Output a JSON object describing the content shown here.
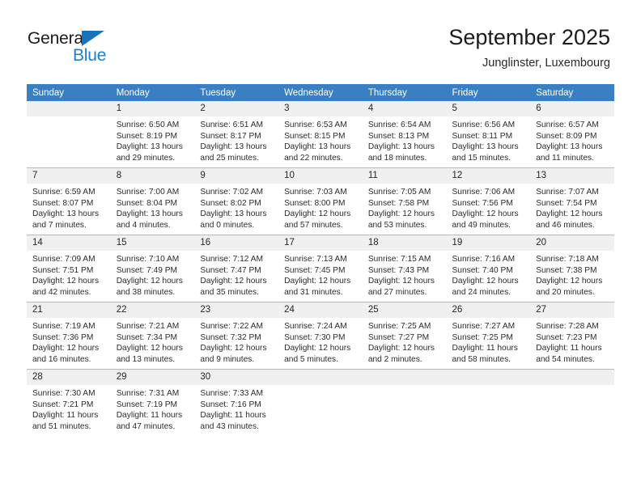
{
  "logo": {
    "word1": "General",
    "word2": "Blue",
    "triangle_color": "#1574bb",
    "blue_color": "#1b7fd4"
  },
  "header": {
    "title": "September 2025",
    "subtitle": "Junglinster, Luxembourg"
  },
  "theme": {
    "header_bg": "#3a7fc1",
    "daynum_bg": "#f0f0f0",
    "grid_line": "#b9b9b9"
  },
  "weekday_headers": [
    "Sunday",
    "Monday",
    "Tuesday",
    "Wednesday",
    "Thursday",
    "Friday",
    "Saturday"
  ],
  "weeks": [
    [
      {
        "day": "",
        "blank": true,
        "sunrise": "",
        "sunset": "",
        "daylight1": "",
        "daylight2": ""
      },
      {
        "day": "1",
        "sunrise": "Sunrise: 6:50 AM",
        "sunset": "Sunset: 8:19 PM",
        "daylight1": "Daylight: 13 hours",
        "daylight2": "and 29 minutes."
      },
      {
        "day": "2",
        "sunrise": "Sunrise: 6:51 AM",
        "sunset": "Sunset: 8:17 PM",
        "daylight1": "Daylight: 13 hours",
        "daylight2": "and 25 minutes."
      },
      {
        "day": "3",
        "sunrise": "Sunrise: 6:53 AM",
        "sunset": "Sunset: 8:15 PM",
        "daylight1": "Daylight: 13 hours",
        "daylight2": "and 22 minutes."
      },
      {
        "day": "4",
        "sunrise": "Sunrise: 6:54 AM",
        "sunset": "Sunset: 8:13 PM",
        "daylight1": "Daylight: 13 hours",
        "daylight2": "and 18 minutes."
      },
      {
        "day": "5",
        "sunrise": "Sunrise: 6:56 AM",
        "sunset": "Sunset: 8:11 PM",
        "daylight1": "Daylight: 13 hours",
        "daylight2": "and 15 minutes."
      },
      {
        "day": "6",
        "sunrise": "Sunrise: 6:57 AM",
        "sunset": "Sunset: 8:09 PM",
        "daylight1": "Daylight: 13 hours",
        "daylight2": "and 11 minutes."
      }
    ],
    [
      {
        "day": "7",
        "sunrise": "Sunrise: 6:59 AM",
        "sunset": "Sunset: 8:07 PM",
        "daylight1": "Daylight: 13 hours",
        "daylight2": "and 7 minutes."
      },
      {
        "day": "8",
        "sunrise": "Sunrise: 7:00 AM",
        "sunset": "Sunset: 8:04 PM",
        "daylight1": "Daylight: 13 hours",
        "daylight2": "and 4 minutes."
      },
      {
        "day": "9",
        "sunrise": "Sunrise: 7:02 AM",
        "sunset": "Sunset: 8:02 PM",
        "daylight1": "Daylight: 13 hours",
        "daylight2": "and 0 minutes."
      },
      {
        "day": "10",
        "sunrise": "Sunrise: 7:03 AM",
        "sunset": "Sunset: 8:00 PM",
        "daylight1": "Daylight: 12 hours",
        "daylight2": "and 57 minutes."
      },
      {
        "day": "11",
        "sunrise": "Sunrise: 7:05 AM",
        "sunset": "Sunset: 7:58 PM",
        "daylight1": "Daylight: 12 hours",
        "daylight2": "and 53 minutes."
      },
      {
        "day": "12",
        "sunrise": "Sunrise: 7:06 AM",
        "sunset": "Sunset: 7:56 PM",
        "daylight1": "Daylight: 12 hours",
        "daylight2": "and 49 minutes."
      },
      {
        "day": "13",
        "sunrise": "Sunrise: 7:07 AM",
        "sunset": "Sunset: 7:54 PM",
        "daylight1": "Daylight: 12 hours",
        "daylight2": "and 46 minutes."
      }
    ],
    [
      {
        "day": "14",
        "sunrise": "Sunrise: 7:09 AM",
        "sunset": "Sunset: 7:51 PM",
        "daylight1": "Daylight: 12 hours",
        "daylight2": "and 42 minutes."
      },
      {
        "day": "15",
        "sunrise": "Sunrise: 7:10 AM",
        "sunset": "Sunset: 7:49 PM",
        "daylight1": "Daylight: 12 hours",
        "daylight2": "and 38 minutes."
      },
      {
        "day": "16",
        "sunrise": "Sunrise: 7:12 AM",
        "sunset": "Sunset: 7:47 PM",
        "daylight1": "Daylight: 12 hours",
        "daylight2": "and 35 minutes."
      },
      {
        "day": "17",
        "sunrise": "Sunrise: 7:13 AM",
        "sunset": "Sunset: 7:45 PM",
        "daylight1": "Daylight: 12 hours",
        "daylight2": "and 31 minutes."
      },
      {
        "day": "18",
        "sunrise": "Sunrise: 7:15 AM",
        "sunset": "Sunset: 7:43 PM",
        "daylight1": "Daylight: 12 hours",
        "daylight2": "and 27 minutes."
      },
      {
        "day": "19",
        "sunrise": "Sunrise: 7:16 AM",
        "sunset": "Sunset: 7:40 PM",
        "daylight1": "Daylight: 12 hours",
        "daylight2": "and 24 minutes."
      },
      {
        "day": "20",
        "sunrise": "Sunrise: 7:18 AM",
        "sunset": "Sunset: 7:38 PM",
        "daylight1": "Daylight: 12 hours",
        "daylight2": "and 20 minutes."
      }
    ],
    [
      {
        "day": "21",
        "sunrise": "Sunrise: 7:19 AM",
        "sunset": "Sunset: 7:36 PM",
        "daylight1": "Daylight: 12 hours",
        "daylight2": "and 16 minutes."
      },
      {
        "day": "22",
        "sunrise": "Sunrise: 7:21 AM",
        "sunset": "Sunset: 7:34 PM",
        "daylight1": "Daylight: 12 hours",
        "daylight2": "and 13 minutes."
      },
      {
        "day": "23",
        "sunrise": "Sunrise: 7:22 AM",
        "sunset": "Sunset: 7:32 PM",
        "daylight1": "Daylight: 12 hours",
        "daylight2": "and 9 minutes."
      },
      {
        "day": "24",
        "sunrise": "Sunrise: 7:24 AM",
        "sunset": "Sunset: 7:30 PM",
        "daylight1": "Daylight: 12 hours",
        "daylight2": "and 5 minutes."
      },
      {
        "day": "25",
        "sunrise": "Sunrise: 7:25 AM",
        "sunset": "Sunset: 7:27 PM",
        "daylight1": "Daylight: 12 hours",
        "daylight2": "and 2 minutes."
      },
      {
        "day": "26",
        "sunrise": "Sunrise: 7:27 AM",
        "sunset": "Sunset: 7:25 PM",
        "daylight1": "Daylight: 11 hours",
        "daylight2": "and 58 minutes."
      },
      {
        "day": "27",
        "sunrise": "Sunrise: 7:28 AM",
        "sunset": "Sunset: 7:23 PM",
        "daylight1": "Daylight: 11 hours",
        "daylight2": "and 54 minutes."
      }
    ],
    [
      {
        "day": "28",
        "sunrise": "Sunrise: 7:30 AM",
        "sunset": "Sunset: 7:21 PM",
        "daylight1": "Daylight: 11 hours",
        "daylight2": "and 51 minutes."
      },
      {
        "day": "29",
        "sunrise": "Sunrise: 7:31 AM",
        "sunset": "Sunset: 7:19 PM",
        "daylight1": "Daylight: 11 hours",
        "daylight2": "and 47 minutes."
      },
      {
        "day": "30",
        "sunrise": "Sunrise: 7:33 AM",
        "sunset": "Sunset: 7:16 PM",
        "daylight1": "Daylight: 11 hours",
        "daylight2": "and 43 minutes."
      },
      {
        "day": "",
        "blank": true,
        "sunrise": "",
        "sunset": "",
        "daylight1": "",
        "daylight2": ""
      },
      {
        "day": "",
        "blank": true,
        "sunrise": "",
        "sunset": "",
        "daylight1": "",
        "daylight2": ""
      },
      {
        "day": "",
        "blank": true,
        "sunrise": "",
        "sunset": "",
        "daylight1": "",
        "daylight2": ""
      },
      {
        "day": "",
        "blank": true,
        "sunrise": "",
        "sunset": "",
        "daylight1": "",
        "daylight2": ""
      }
    ]
  ]
}
